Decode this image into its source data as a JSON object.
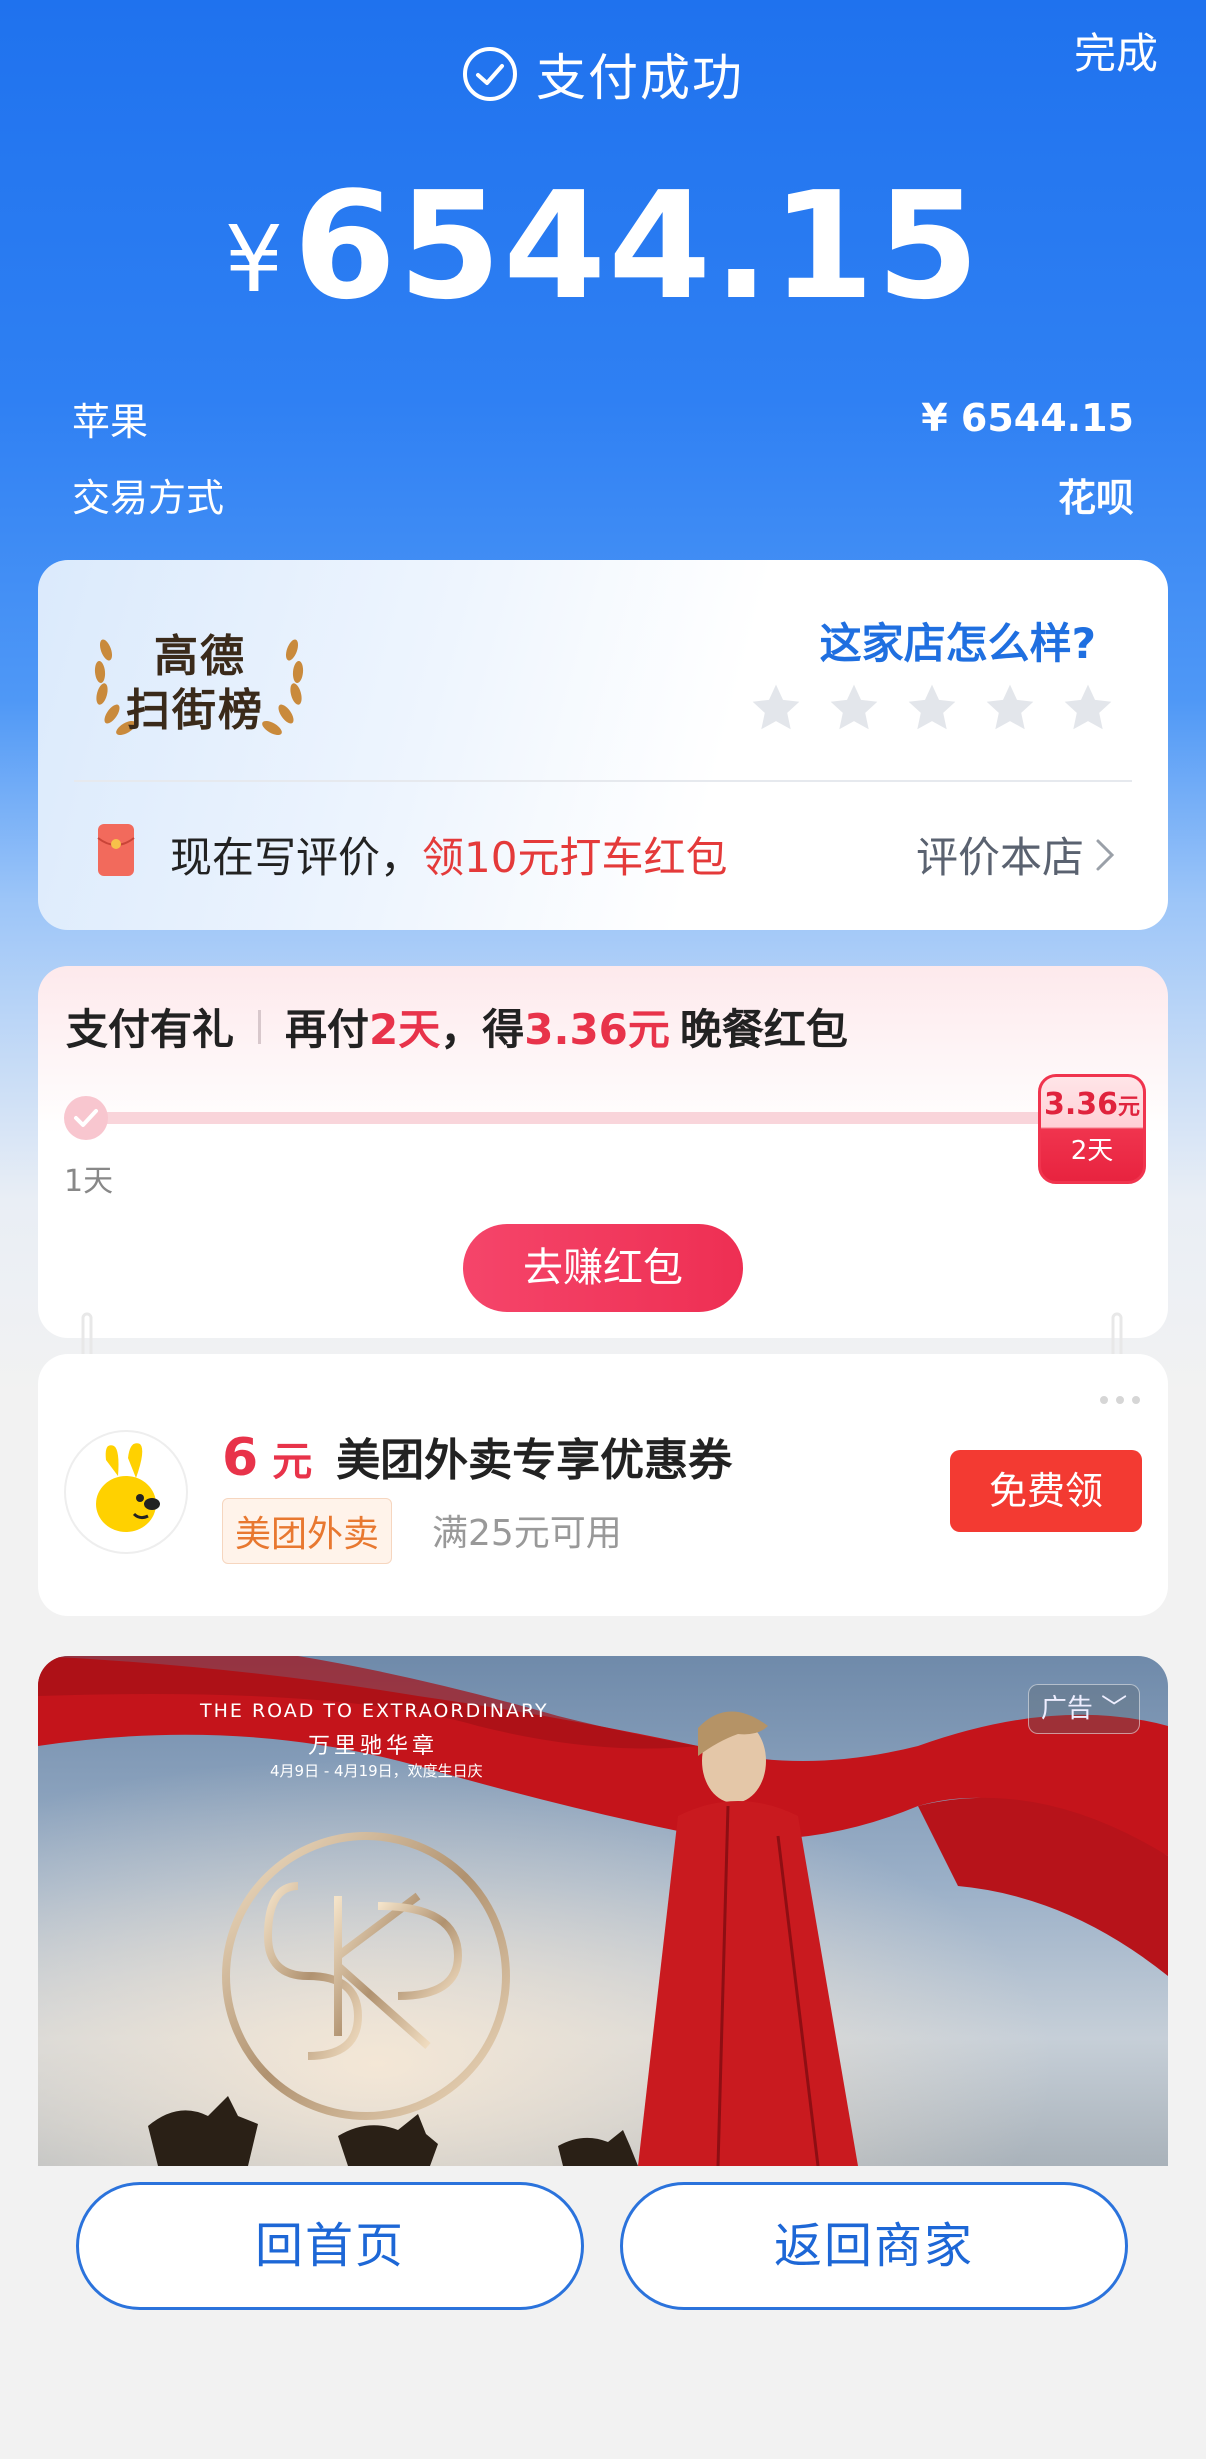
{
  "header": {
    "title": "支付成功",
    "done_label": "完成",
    "currency_symbol": "¥",
    "amount": "6544.15"
  },
  "details": [
    {
      "label": "苹果",
      "value": "¥ 6544.15"
    },
    {
      "label": "交易方式",
      "value": "花呗"
    }
  ],
  "review_card": {
    "logo_line1": "高德",
    "logo_line2": "扫街榜",
    "question": "这家店怎么样?",
    "star_count": 5,
    "prompt_prefix": "现在写评价，",
    "prompt_highlight": "领10元打车红包",
    "link_label": "评价本店"
  },
  "gift_card": {
    "title": "支付有礼",
    "text_1": "再付",
    "days": "2天",
    "text_2": "，得",
    "reward": "3.36元",
    "text_3": "晚餐红包",
    "start_label": "1天",
    "badge_amount": "3.36",
    "badge_unit": "元",
    "badge_days": "2天",
    "progress": 0.5,
    "button_label": "去赚红包"
  },
  "coupon_card": {
    "amount": "6",
    "unit": "元",
    "title": "美团外卖专享优惠券",
    "tag": "美团外卖",
    "condition": "满25元可用",
    "button_label": "免费领"
  },
  "ad": {
    "headline": "THE ROAD TO EXTRAORDINARY",
    "subtitle": "万里驰华章",
    "date_text": "4月9日 - 4月19日，欢度生日庆",
    "tag_label": "广告"
  },
  "bottom_bar": {
    "home_label": "回首页",
    "back_label": "返回商家"
  },
  "colors": {
    "primary_blue": "#1f72ee",
    "accent_red": "#e8334a",
    "button_red": "#f33a32"
  }
}
